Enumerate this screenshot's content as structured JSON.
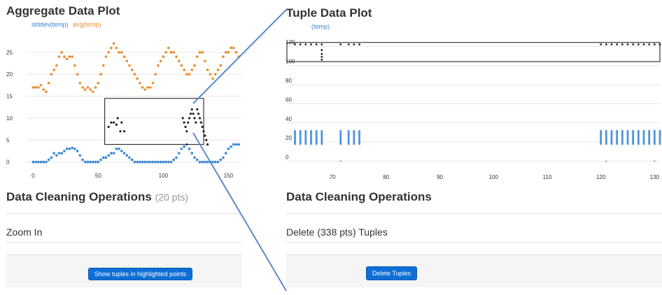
{
  "left": {
    "title": "Aggregate Data Plot",
    "legend": [
      {
        "label": "stddev(temp)",
        "color": "#3a86d6"
      },
      {
        "label": "avg(temp)",
        "color": "#ee8c2a"
      }
    ],
    "ops_title": "Data Cleaning Operations",
    "ops_pts": "(20 pts)",
    "operation": "Zoom In",
    "button": "Show tuples in highlighted points"
  },
  "right": {
    "title": "Tuple Data Plot",
    "legend": [
      {
        "label": "(temp)",
        "color": "#3a86d6"
      }
    ],
    "ops_title": "Data Cleaning Operations",
    "operation": "Delete (338 pts) Tuples",
    "button": "Delete Tuples"
  },
  "colors": {
    "accent": "#0f6fd6",
    "blue": "#3a86d6",
    "orange": "#ee8c2a",
    "highlight": "#222222"
  },
  "chart_data": [
    {
      "type": "scatter",
      "title": "Aggregate Data Plot",
      "x_ticks": [
        "0",
        "50",
        "100",
        "150"
      ],
      "y_ticks": [
        "0",
        "5",
        "10",
        "15",
        "20",
        "25"
      ],
      "xlim": [
        -5,
        160
      ],
      "ylim": [
        -1,
        28
      ],
      "series": [
        {
          "name": "stddev(temp)",
          "color": "#3a86d6",
          "points": [
            [
              0,
              0
            ],
            [
              2,
              0
            ],
            [
              4,
              0
            ],
            [
              6,
              0
            ],
            [
              8,
              0
            ],
            [
              10,
              0
            ],
            [
              12,
              0.5
            ],
            [
              14,
              1
            ],
            [
              16,
              2
            ],
            [
              18,
              1.5
            ],
            [
              20,
              2
            ],
            [
              22,
              2
            ],
            [
              24,
              2.5
            ],
            [
              26,
              3
            ],
            [
              28,
              3
            ],
            [
              30,
              3.2
            ],
            [
              32,
              3
            ],
            [
              34,
              2.5
            ],
            [
              36,
              1.5
            ],
            [
              38,
              0.5
            ],
            [
              40,
              0
            ],
            [
              42,
              0
            ],
            [
              44,
              0
            ],
            [
              46,
              0
            ],
            [
              48,
              0
            ],
            [
              50,
              0
            ],
            [
              52,
              0.5
            ],
            [
              54,
              1
            ],
            [
              56,
              1
            ],
            [
              58,
              1.5
            ],
            [
              60,
              2
            ],
            [
              62,
              2
            ],
            [
              64,
              3
            ],
            [
              66,
              3
            ],
            [
              68,
              2.5
            ],
            [
              70,
              2
            ],
            [
              72,
              1.5
            ],
            [
              74,
              1
            ],
            [
              76,
              0.5
            ],
            [
              78,
              0
            ],
            [
              80,
              0
            ],
            [
              82,
              0
            ],
            [
              84,
              0
            ],
            [
              86,
              0
            ],
            [
              88,
              0
            ],
            [
              90,
              0
            ],
            [
              92,
              0
            ],
            [
              94,
              0
            ],
            [
              96,
              0
            ],
            [
              98,
              0
            ],
            [
              100,
              0
            ],
            [
              102,
              0
            ],
            [
              104,
              0
            ],
            [
              106,
              0
            ],
            [
              108,
              0.5
            ],
            [
              110,
              1
            ],
            [
              112,
              2
            ],
            [
              114,
              3
            ],
            [
              116,
              3.5
            ],
            [
              118,
              4
            ],
            [
              120,
              3
            ],
            [
              122,
              2
            ],
            [
              124,
              1
            ],
            [
              126,
              0.5
            ],
            [
              128,
              0
            ],
            [
              130,
              0
            ],
            [
              132,
              0
            ],
            [
              134,
              0
            ],
            [
              136,
              0
            ],
            [
              138,
              0
            ],
            [
              140,
              0
            ],
            [
              142,
              0
            ],
            [
              144,
              0.5
            ],
            [
              146,
              1
            ],
            [
              148,
              2
            ],
            [
              150,
              3
            ],
            [
              152,
              3.5
            ],
            [
              154,
              4
            ],
            [
              156,
              4
            ],
            [
              158,
              4
            ]
          ]
        },
        {
          "name": "avg(temp)",
          "color": "#ee8c2a",
          "points": [
            [
              0,
              17
            ],
            [
              2,
              17
            ],
            [
              4,
              17
            ],
            [
              6,
              17.5
            ],
            [
              8,
              16.5
            ],
            [
              10,
              16
            ],
            [
              12,
              18
            ],
            [
              14,
              20
            ],
            [
              16,
              21
            ],
            [
              18,
              22
            ],
            [
              20,
              24
            ],
            [
              22,
              25
            ],
            [
              24,
              24
            ],
            [
              26,
              23.5
            ],
            [
              28,
              24
            ],
            [
              30,
              24
            ],
            [
              32,
              22
            ],
            [
              34,
              20
            ],
            [
              36,
              18
            ],
            [
              38,
              17
            ],
            [
              40,
              16.5
            ],
            [
              42,
              17
            ],
            [
              44,
              16.5
            ],
            [
              46,
              16
            ],
            [
              48,
              17
            ],
            [
              50,
              18
            ],
            [
              52,
              20
            ],
            [
              54,
              22
            ],
            [
              56,
              24
            ],
            [
              58,
              25
            ],
            [
              60,
              26
            ],
            [
              62,
              27
            ],
            [
              64,
              26
            ],
            [
              66,
              25
            ],
            [
              68,
              25
            ],
            [
              70,
              24
            ],
            [
              72,
              23
            ],
            [
              74,
              22
            ],
            [
              76,
              21
            ],
            [
              78,
              20
            ],
            [
              80,
              19
            ],
            [
              82,
              18
            ],
            [
              84,
              17
            ],
            [
              86,
              16.5
            ],
            [
              88,
              17
            ],
            [
              90,
              17
            ],
            [
              92,
              18
            ],
            [
              94,
              20
            ],
            [
              96,
              22
            ],
            [
              98,
              23
            ],
            [
              100,
              24
            ],
            [
              102,
              25
            ],
            [
              104,
              26
            ],
            [
              106,
              25
            ],
            [
              108,
              25
            ],
            [
              110,
              24
            ],
            [
              112,
              23
            ],
            [
              114,
              22
            ],
            [
              116,
              21
            ],
            [
              118,
              20
            ],
            [
              120,
              20
            ],
            [
              122,
              21
            ],
            [
              124,
              22
            ],
            [
              126,
              24
            ],
            [
              128,
              25
            ],
            [
              130,
              25
            ],
            [
              132,
              23
            ],
            [
              134,
              21
            ],
            [
              136,
              20
            ],
            [
              138,
              19
            ],
            [
              140,
              20
            ],
            [
              142,
              21
            ],
            [
              144,
              22
            ],
            [
              146,
              24
            ],
            [
              148,
              25
            ],
            [
              150,
              25
            ],
            [
              152,
              26
            ],
            [
              154,
              26
            ],
            [
              156,
              25
            ],
            [
              158,
              24
            ]
          ]
        },
        {
          "name": "highlighted",
          "color": "#222222",
          "points": [
            [
              58,
              8
            ],
            [
              60,
              9
            ],
            [
              62,
              9
            ],
            [
              64,
              8.5
            ],
            [
              65,
              10
            ],
            [
              67,
              7
            ],
            [
              68,
              9
            ],
            [
              70,
              7
            ],
            [
              115,
              10
            ],
            [
              116,
              9
            ],
            [
              117,
              8
            ],
            [
              118,
              7
            ],
            [
              119,
              9
            ],
            [
              120,
              10
            ],
            [
              121,
              11
            ],
            [
              122,
              12
            ],
            [
              123,
              11
            ],
            [
              124,
              10
            ],
            [
              125,
              9
            ],
            [
              126,
              12
            ],
            [
              127,
              11
            ],
            [
              128,
              10
            ],
            [
              129,
              9
            ],
            [
              130,
              8
            ],
            [
              131,
              7
            ],
            [
              132,
              6
            ],
            [
              133,
              5
            ],
            [
              134,
              4
            ]
          ]
        }
      ],
      "highlight_box": {
        "x": [
          55,
          131
        ],
        "y": [
          4,
          14.5
        ]
      }
    },
    {
      "type": "scatter",
      "title": "Tuple Data Plot",
      "x_ticks": [
        "70",
        "80",
        "90",
        "100",
        "110",
        "120",
        "130"
      ],
      "y_ticks": [
        "0",
        "20",
        "40",
        "60",
        "80",
        "100",
        "120"
      ],
      "xlim": [
        61.5,
        131
      ],
      "ylim": [
        -4,
        126
      ],
      "series": [
        {
          "name": "(temp)",
          "color": "#3a86d6",
          "columns_x": [
            63,
            64,
            65,
            66,
            67,
            68,
            71.5,
            73,
            74,
            75,
            120,
            121,
            122,
            123,
            124,
            125,
            126,
            127,
            128,
            129,
            130,
            131
          ],
          "y_min": 18,
          "y_max": 32
        }
      ],
      "outliers": {
        "color": "#222222",
        "top_x": [
          63,
          64,
          65,
          66,
          67,
          68,
          71.5,
          73,
          74,
          75,
          120,
          121,
          122,
          123,
          124,
          125,
          126,
          127,
          128,
          129,
          130,
          131
        ],
        "top_y": 122,
        "drop_x": 68,
        "drop_y": [
          116,
          112,
          109,
          106
        ]
      },
      "highlight_box": {
        "x": [
          61.5,
          132
        ],
        "y": [
          104,
          124
        ]
      }
    }
  ]
}
